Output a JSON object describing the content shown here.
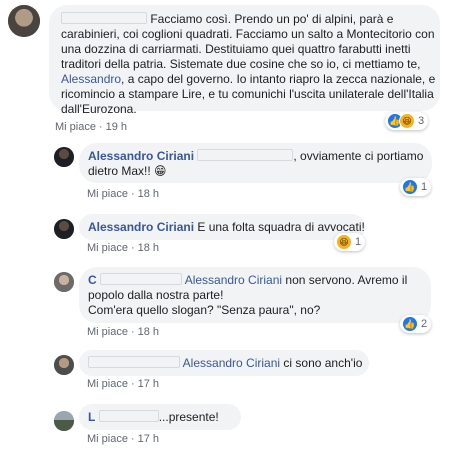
{
  "comments": [
    {
      "text_lines": [
        "Facciamo così. Prendo un po' di alpini, parà e",
        "carabinieri, coi coglioni quadrati. Facciamo un salto a Montecitorio con",
        "una dozzina di carriarmati. Destituiamo quei quattro farabutti inetti",
        "traditori della patria. Sistemate due cosine che so io, ci mettiamo te,",
        "a capo del governo. Io intanto riapro la zecca nazionale, e",
        "ricomincio a stampare Lire, e tu comunichi l'uscita unilaterale dell'Italia",
        "dall'Eurozona."
      ],
      "mention": "Alessandro",
      "like_label": "Mi piace",
      "time": "19 h",
      "reaction_count": "3"
    },
    {
      "name": "Alessandro Ciriani",
      "text_line1": ", ovviamente ci portiamo",
      "text_line2": "dietro Max!! 😁",
      "like_label": "Mi piace",
      "time": "18 h",
      "reaction_count": "1"
    },
    {
      "name": "Alessandro Ciriani",
      "text": "E una folta squadra di avvocati!",
      "like_label": "Mi piace",
      "time": "18 h",
      "reaction_count": "1"
    },
    {
      "name_initial": "C",
      "mention": "Alessandro Ciriani",
      "text_line1": "non servono. Avremo il",
      "text_line2": "popolo dalla nostra parte!",
      "text_line3": "Com'era quello slogan? \"Senza paura\", no?",
      "like_label": "Mi piace",
      "time": "18 h",
      "reaction_count": "2"
    },
    {
      "mention": "Alessandro Ciriani",
      "text": "ci sono anch'io",
      "like_label": "Mi piace",
      "time": "17 h"
    },
    {
      "name_partial": "L",
      "text": "...presente!",
      "like_label": "Mi piace",
      "time": "17 h"
    }
  ],
  "colors": {
    "link": "#385898",
    "bubble": "#f2f3f5",
    "meta": "#606770",
    "like_reaction": "#1877f2",
    "haha_reaction": "#f7b125"
  },
  "icons": [
    "like-reaction-icon",
    "haha-reaction-icon"
  ]
}
